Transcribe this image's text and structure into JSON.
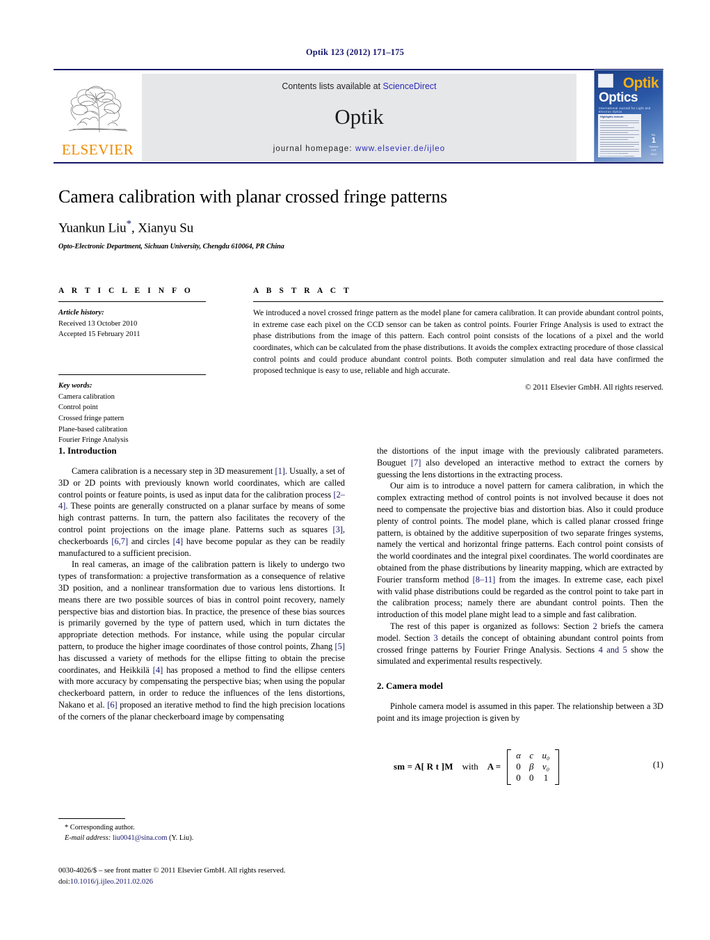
{
  "running_head": "Optik 123 (2012) 171–175",
  "masthead": {
    "publisher_name": "ELSEVIER",
    "contents_prefix": "Contents lists available at ",
    "contents_link": "ScienceDirect",
    "journal_name": "Optik",
    "homepage_label": "journal  homepage:  ",
    "homepage_url": "www.elsevier.de/ijleo",
    "cover": {
      "brand_top": "Optik",
      "brand_bottom": "Optics",
      "subtitle": "International Journal for Light and Electron Optics",
      "panel_title": "Highlights include:",
      "issue_label": "No.",
      "issue_number": "1",
      "issue_volume": "Volume 123",
      "issue_year": "2012",
      "footer_note": "Available online at www.sciencedirect.com"
    }
  },
  "title": "Camera calibration with planar crossed fringe patterns",
  "authors": "Yuankun Liu",
  "authors_rest": ", Xianyu Su",
  "author_marker": "*",
  "affiliation": "Opto-Electronic Department, Sichuan University, Chengdu 610064, PR China",
  "article_info": {
    "heading": "A R T I C L E   I N F O",
    "history_label": "Article history:",
    "history": [
      "Received 13 October 2010",
      "Accepted 15 February 2011"
    ],
    "keywords_label": "Key words:",
    "keywords": [
      "Camera calibration",
      "Control point",
      "Crossed fringe pattern",
      "Plane-based calibration",
      "Fourier Fringe Analysis"
    ]
  },
  "abstract": {
    "heading": "A B S T R A C T",
    "text": "We introduced a novel crossed fringe pattern as the model plane for camera calibration. It can provide abundant control points, in extreme case each pixel on the CCD sensor can be taken as control points. Fourier Fringe Analysis is used to extract the phase distributions from the image of this pattern. Each control point consists of the locations of a pixel and the world coordinates, which can be calculated from the phase distributions. It avoids the complex extracting procedure of those classical control points and could produce abundant control points. Both computer simulation and real data have confirmed the proposed technique is easy to use, reliable and high accurate.",
    "copyright": "© 2011 Elsevier GmbH. All rights reserved."
  },
  "sections": {
    "introduction_heading": "1.  Introduction",
    "camera_model_heading": "2.  Camera model"
  },
  "left_column": {
    "p1_a": "Camera calibration is a necessary step in 3D measurement ",
    "p1_r1": "[1]",
    "p1_b": ". Usually, a set of 3D or 2D points with previously known world coordinates, which are called control points or feature points, is used as input data for the calibration process ",
    "p1_r2": "[2–4]",
    "p1_c": ". These points are generally constructed on a planar surface by means of some high contrast patterns. In turn, the pattern also facilitates the recovery of the control point projections on the image plane. Patterns such as squares ",
    "p1_r3": "[3]",
    "p1_d": ", checkerboards ",
    "p1_r4": "[6,7]",
    "p1_e": " and circles ",
    "p1_r5": "[4]",
    "p1_f": " have become popular as they can be readily manufactured to a sufficient precision.",
    "p2_a": "In real cameras, an image of the calibration pattern is likely to undergo two types of transformation: a projective transformation as a consequence of relative 3D position, and a nonlinear transformation due to various lens distortions. It means there are two possible sources of bias in control point recovery, namely perspective bias and distortion bias. In practice, the presence of these bias sources is primarily governed by the type of pattern used, which in turn dictates the appropriate detection methods. For instance, while using the popular circular pattern, to produce the higher image coordinates of those control points, Zhang ",
    "p2_r1": "[5]",
    "p2_b": " has discussed a variety of methods for the ellipse fitting to obtain the precise coordinates, and Heikkilä ",
    "p2_r2": "[4]",
    "p2_c": " has proposed a method to find the ellipse centers with more accuracy by compensating the perspective bias; when using the popular checkerboard pattern, in order to reduce the influences of the lens distortions, Nakano et al. ",
    "p2_r3": "[6]",
    "p2_d": " proposed an iterative method to find the high precision locations of the corners of the planar checkerboard image by compensating"
  },
  "right_column": {
    "p1_a": "the distortions of the input image with the previously calibrated parameters. Bouguet ",
    "p1_r1": "[7]",
    "p1_b": " also developed an interactive method to extract the corners by guessing the lens distortions in the extracting process.",
    "p2_a": "Our aim is to introduce a novel pattern for camera calibration, in which the complex extracting method of control points is not involved because it does not need to compensate the projective bias and distortion bias. Also it could produce plenty of control points. The model plane, which is called planar crossed fringe pattern, is obtained by the additive superposition of two separate fringes systems, namely the vertical and horizontal fringe patterns. Each control point consists of the world coordinates and the integral pixel coordinates. The world coordinates are obtained from the phase distributions by linearity mapping, which are extracted by Fourier transform method ",
    "p2_r1": "[8–11]",
    "p2_b": " from the images. In extreme case, each pixel with valid phase distributions could be regarded as the control point to take part in the calibration process; namely there are abundant control points. Then the introduction of this model plane might lead to a simple and fast calibration.",
    "p3_a": "The rest of this paper is organized as follows: Section ",
    "p3_r1": "2",
    "p3_b": " briefs the camera model. Section ",
    "p3_r2": "3",
    "p3_c": " details the concept of obtaining abundant control points from crossed fringe patterns by Fourier Fringe Analysis. Sections ",
    "p3_r3": "4 and 5",
    "p3_d": " show the simulated and experimental results respectively.",
    "p4": "Pinhole camera model is assumed in this paper. The relationship between a 3D point and its image projection is given by"
  },
  "equation": {
    "lhs": "sm = A[ R   t ]M",
    "with": "with",
    "a_label": "A =",
    "matrix": [
      [
        "α",
        "c",
        "u₀"
      ],
      [
        "0",
        "β",
        "v₀"
      ],
      [
        "0",
        "0",
        "1"
      ]
    ],
    "number": "(1)"
  },
  "footnote": {
    "marker": "*",
    "corresponding": " Corresponding author.",
    "email_label": "E-mail address:",
    "email": "liu0041@sina.com",
    "email_owner": " (Y. Liu)."
  },
  "imprint": {
    "line1": "0030-4026/$ – see front matter © 2011 Elsevier GmbH. All rights reserved.",
    "doi_label": "doi:",
    "doi": "10.1016/j.ijleo.2011.02.026"
  },
  "colors": {
    "link_blue": "#2b2bb5",
    "ref_blue": "#16166b",
    "elsevier_orange": "#ed8b00",
    "masthead_grey": "#e6e7e9"
  }
}
